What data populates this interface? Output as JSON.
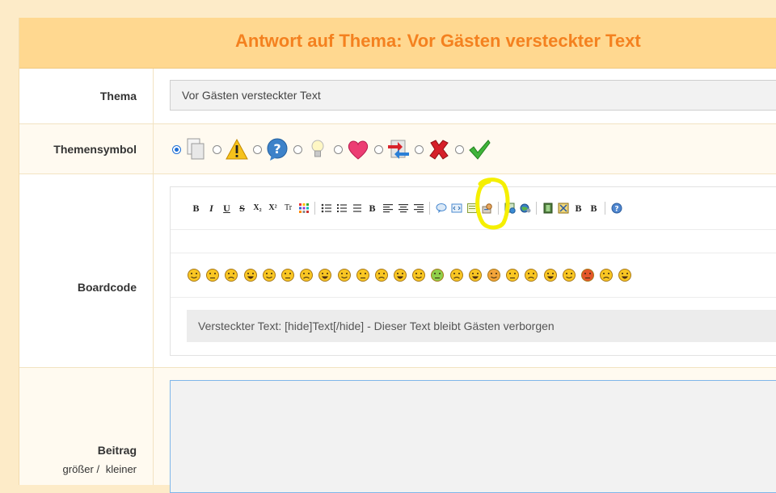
{
  "header": {
    "title": "Antwort auf Thema: Vor Gästen versteckter Text"
  },
  "thema": {
    "label": "Thema",
    "value": "Vor Gästen versteckter Text"
  },
  "themensymbol": {
    "label": "Themensymbol",
    "icons": [
      "document-icon",
      "warning-icon",
      "question-icon",
      "lightbulb-icon",
      "heart-icon",
      "exchange-icon",
      "cross-icon",
      "check-icon"
    ],
    "selected_index": 0
  },
  "boardcode": {
    "label": "Boardcode",
    "toolbar": {
      "bold": "B",
      "italic": "I",
      "underline": "U",
      "strike": "S",
      "subscript": "X₂",
      "superscript": "X²",
      "font": "Tr",
      "bold2": "B",
      "bold3": "B"
    },
    "smileys_count": 24,
    "hint": "Versteckter Text: [hide]Text[/hide] - Dieser Text bleibt Gästen verborgen"
  },
  "beitrag": {
    "label": "Beitrag",
    "bigger": "größer",
    "separator": "/",
    "smaller": "kleiner"
  },
  "colors": {
    "accent": "#f4811f",
    "header_bg": "#ffd890",
    "highlight": "#f5ef00"
  }
}
